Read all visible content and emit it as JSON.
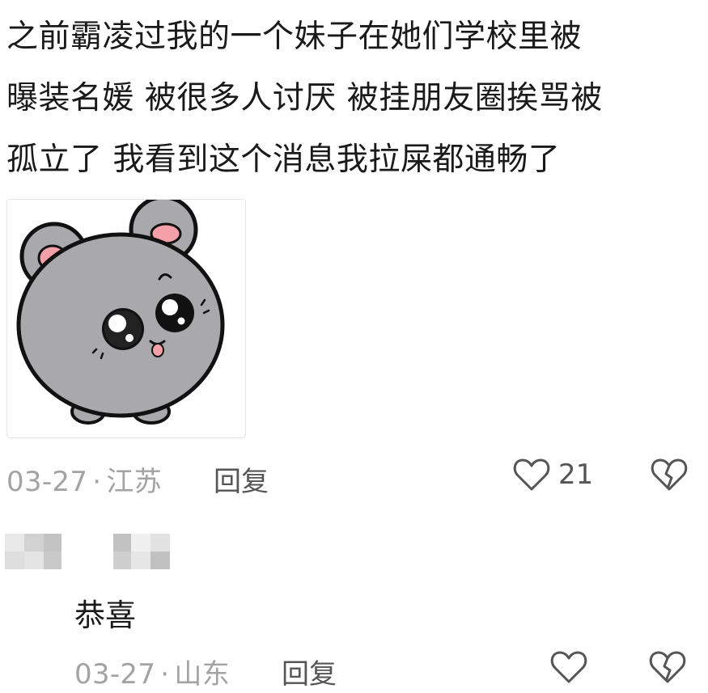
{
  "post": {
    "lines": [
      "之前霸凌过我的一个妹子在她们学校里被",
      "曝装名媛 被很多人讨厌 被挂朋友圈挨骂被",
      "孤立了 我看到这个消息我拉屎都通畅了"
    ],
    "sticker_icon": "gray-mouse-sticker",
    "date": "03-27",
    "separator": "·",
    "location": "江苏",
    "reply_label": "回复",
    "like_count": "21",
    "like_icon": "heart-outline-icon",
    "dislike_icon": "broken-heart-icon"
  },
  "reply": {
    "username_icon": "pixelated-username",
    "text": "恭喜",
    "date": "03-27",
    "separator": "·",
    "location": "山东",
    "reply_label": "回复",
    "like_icon": "heart-outline-icon",
    "dislike_icon": "broken-heart-icon"
  },
  "colors": {
    "meta_gray": "#a3a3a3",
    "action_gray": "#555555",
    "sticker_pink": "#f4a0a8",
    "sticker_gray": "#a9a9ab"
  }
}
